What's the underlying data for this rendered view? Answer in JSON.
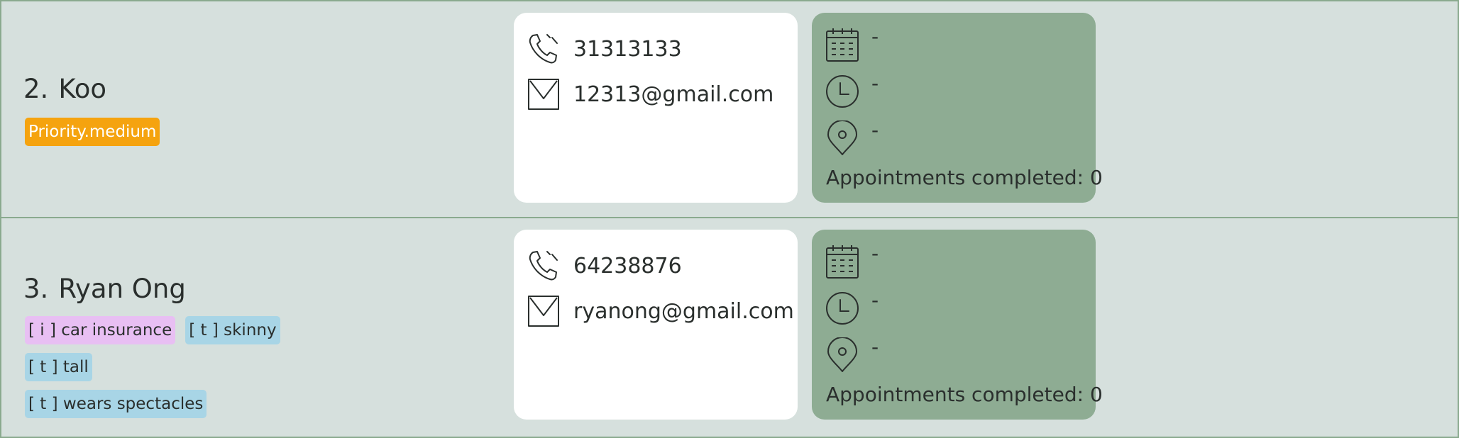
{
  "persons": [
    {
      "index": "2.",
      "name": "Koo",
      "tags": [
        {
          "label": "Priority.medium",
          "kind": "priority",
          "color": "#f5a30f"
        }
      ],
      "phone": "31313133",
      "email": "12313@gmail.com",
      "appointment": {
        "date": "-",
        "time": "-",
        "location": "-",
        "completed": "Appointments completed: 0"
      }
    },
    {
      "index": "3.",
      "name": "Ryan Ong",
      "tags": [
        {
          "label": "[ i ] car insurance",
          "kind": "insurance",
          "color": "#e8bff3"
        },
        {
          "label": "[ t ] skinny",
          "kind": "trait",
          "color": "#a8d5e6"
        },
        {
          "label": "[ t ] tall",
          "kind": "trait",
          "color": "#a8d5e6"
        },
        {
          "label": "[ t ] wears spectacles",
          "kind": "trait",
          "color": "#a8d5e6"
        }
      ],
      "phone": "64238876",
      "email": "ryanong@gmail.com",
      "appointment": {
        "date": "-",
        "time": "-",
        "location": "-",
        "completed": "Appointments completed: 0"
      }
    }
  ],
  "icons": {
    "phone": "phone-icon",
    "email": "mail-icon",
    "date": "calendar-icon",
    "time": "clock-icon",
    "location": "location-pin-icon"
  },
  "colors": {
    "background": "#d6e0dd",
    "border": "#8aaa8e",
    "contact_panel": "#ffffff",
    "appointment_panel": "#8eac93"
  }
}
